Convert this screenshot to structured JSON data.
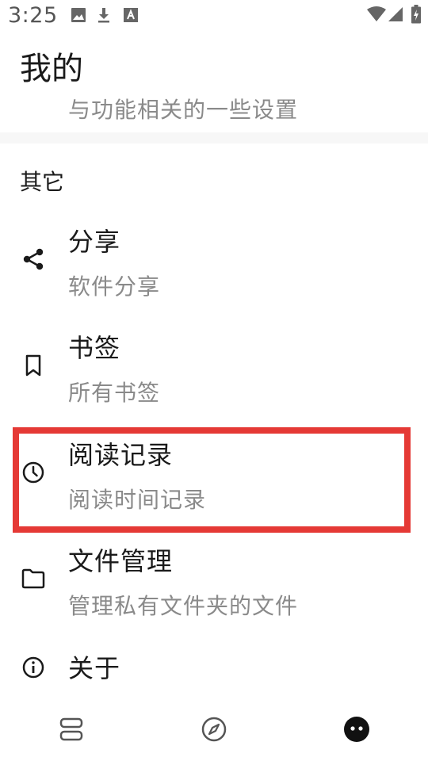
{
  "status_bar": {
    "time": "3:25",
    "icons": [
      "image-icon",
      "download-icon",
      "text-a-icon",
      "wifi-icon",
      "signal-icon",
      "battery-charging-icon"
    ]
  },
  "header": {
    "title": "我的",
    "subtitle": "与功能相关的一些设置"
  },
  "section": {
    "title": "其它",
    "items": [
      {
        "title": "分享",
        "subtitle": "软件分享",
        "icon": "share-icon"
      },
      {
        "title": "书签",
        "subtitle": "所有书签",
        "icon": "bookmark-icon"
      },
      {
        "title": "阅读记录",
        "subtitle": "阅读时间记录",
        "icon": "clock-icon"
      },
      {
        "title": "文件管理",
        "subtitle": "管理私有文件夹的文件",
        "icon": "folder-icon"
      },
      {
        "title": "关于",
        "subtitle": "",
        "icon": "info-icon"
      }
    ]
  },
  "highlight": {
    "target": "阅读记录",
    "color": "#e53935"
  },
  "bottom_nav": {
    "items": [
      {
        "icon": "shelf-icon",
        "active": false
      },
      {
        "icon": "compass-icon",
        "active": false
      },
      {
        "icon": "face-icon",
        "active": true
      }
    ]
  }
}
